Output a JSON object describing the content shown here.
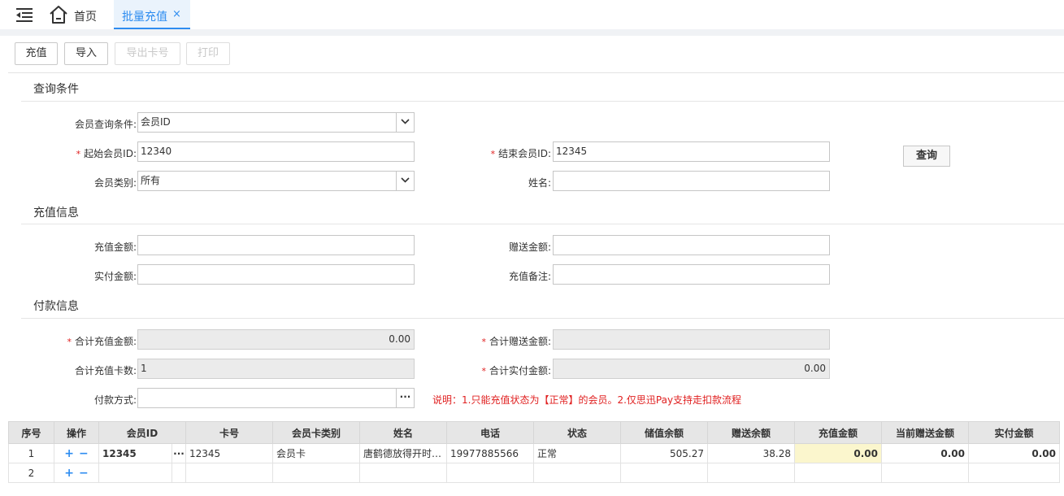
{
  "topbar": {
    "menu_icon": "menu-collapse-icon",
    "home_icon": "home-icon",
    "home_label": "首页",
    "active_tab_label": "批量充值",
    "close_glyph": "×"
  },
  "toolbar": {
    "recharge": "充值",
    "import": "导入",
    "export_card": "导出卡号",
    "print": "打印"
  },
  "query": {
    "title": "查询条件",
    "condition_label": "会员查询条件:",
    "condition_value": "会员ID",
    "start_id_label": "起始会员ID:",
    "start_id_value": "12340",
    "end_id_label": "结束会员ID:",
    "end_id_value": "12345",
    "category_label": "会员类别:",
    "category_value": "所有",
    "name_label": "姓名:",
    "name_value": "",
    "query_button": "查询"
  },
  "recharge_info": {
    "title": "充值信息",
    "amount_label": "充值金额:",
    "amount_value": "",
    "gift_label": "赠送金额:",
    "gift_value": "",
    "paid_label": "实付金额:",
    "paid_value": "",
    "remark_label": "充值备注:",
    "remark_value": ""
  },
  "payment": {
    "title": "付款信息",
    "total_recharge_label": "合计充值金额:",
    "total_recharge_value": "0.00",
    "total_gift_label": "合计赠送金额:",
    "total_gift_value": "",
    "total_cards_label": "合计充值卡数:",
    "total_cards_value": "1",
    "total_paid_label": "合计实付金额:",
    "total_paid_value": "0.00",
    "method_label": "付款方式:",
    "method_value": "",
    "note": "说明：1.只能充值状态为【正常】的会员。2.仅思迅Pay支持走扣款流程"
  },
  "required_mark": "*",
  "dots": "···",
  "grid": {
    "headers": [
      "序号",
      "操作",
      "会员ID",
      "卡号",
      "会员卡类别",
      "姓名",
      "电话",
      "状态",
      "储值余额",
      "赠送余额",
      "充值金额",
      "当前赠送金额",
      "实付金额"
    ],
    "rows": [
      {
        "no": "1",
        "plus": "+",
        "minus": "−",
        "member_id": "12345",
        "card_no": "12345",
        "card_type": "会员卡",
        "name": "唐鹤德放得开时…",
        "phone": "19977885566",
        "status": "正常",
        "balance": "505.27",
        "gift_balance": "38.28",
        "recharge": "0.00",
        "cur_gift": "0.00",
        "paid": "0.00"
      },
      {
        "no": "2",
        "plus": "+",
        "minus": "−",
        "member_id": "",
        "card_no": "",
        "card_type": "",
        "name": "",
        "phone": "",
        "status": "",
        "balance": "",
        "gift_balance": "",
        "recharge": "",
        "cur_gift": "",
        "paid": ""
      }
    ]
  }
}
